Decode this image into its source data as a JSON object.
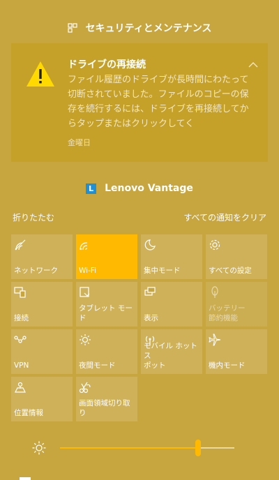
{
  "security_header": {
    "label": "セキュリティとメンテナンス"
  },
  "notification": {
    "title": "ドライブの再接続",
    "body": "ファイル履歴のドライブが長時間にわたって切断されていました。ファイルのコピーの保存を続行するには、ドライブを再接続してからタップまたはクリックしてく",
    "time": "金曜日"
  },
  "lenovo_header": {
    "label": "Lenovo Vantage",
    "icon_letter": "L"
  },
  "actions": {
    "collapse": "折りたたむ",
    "clear_all": "すべての通知をクリア"
  },
  "tiles": [
    {
      "label": "ネットワーク",
      "icon": "network-icon",
      "state": "normal"
    },
    {
      "label": "Wi-Fi",
      "icon": "wifi-icon",
      "state": "active"
    },
    {
      "label": "集中モード",
      "icon": "moon-icon",
      "state": "normal"
    },
    {
      "label": "すべての設定",
      "icon": "gear-icon",
      "state": "normal"
    },
    {
      "label": "接続",
      "icon": "connect-icon",
      "state": "normal"
    },
    {
      "label": "タブレット モード",
      "icon": "tablet-icon",
      "state": "normal"
    },
    {
      "label": "表示",
      "icon": "display-icon",
      "state": "normal"
    },
    {
      "label": "バッテリー\n節約機能",
      "icon": "battery-saver-icon",
      "state": "disabled"
    },
    {
      "label": "VPN",
      "icon": "vpn-icon",
      "state": "normal"
    },
    {
      "label": "夜間モード",
      "icon": "night-light-icon",
      "state": "normal"
    },
    {
      "label": "モバイル ホットス\nポット",
      "icon": "hotspot-icon",
      "state": "normal"
    },
    {
      "label": "機内モード",
      "icon": "airplane-icon",
      "state": "normal"
    },
    {
      "label": "位置情報",
      "icon": "location-icon",
      "state": "normal"
    },
    {
      "label": "画面領域切り取\nり",
      "icon": "snip-icon",
      "state": "normal"
    }
  ],
  "brightness": {
    "value_fraction": 0.79
  },
  "colors": {
    "background": "#c7a53f",
    "accent": "#ffb900",
    "notification_bg": "#c5a12a"
  }
}
